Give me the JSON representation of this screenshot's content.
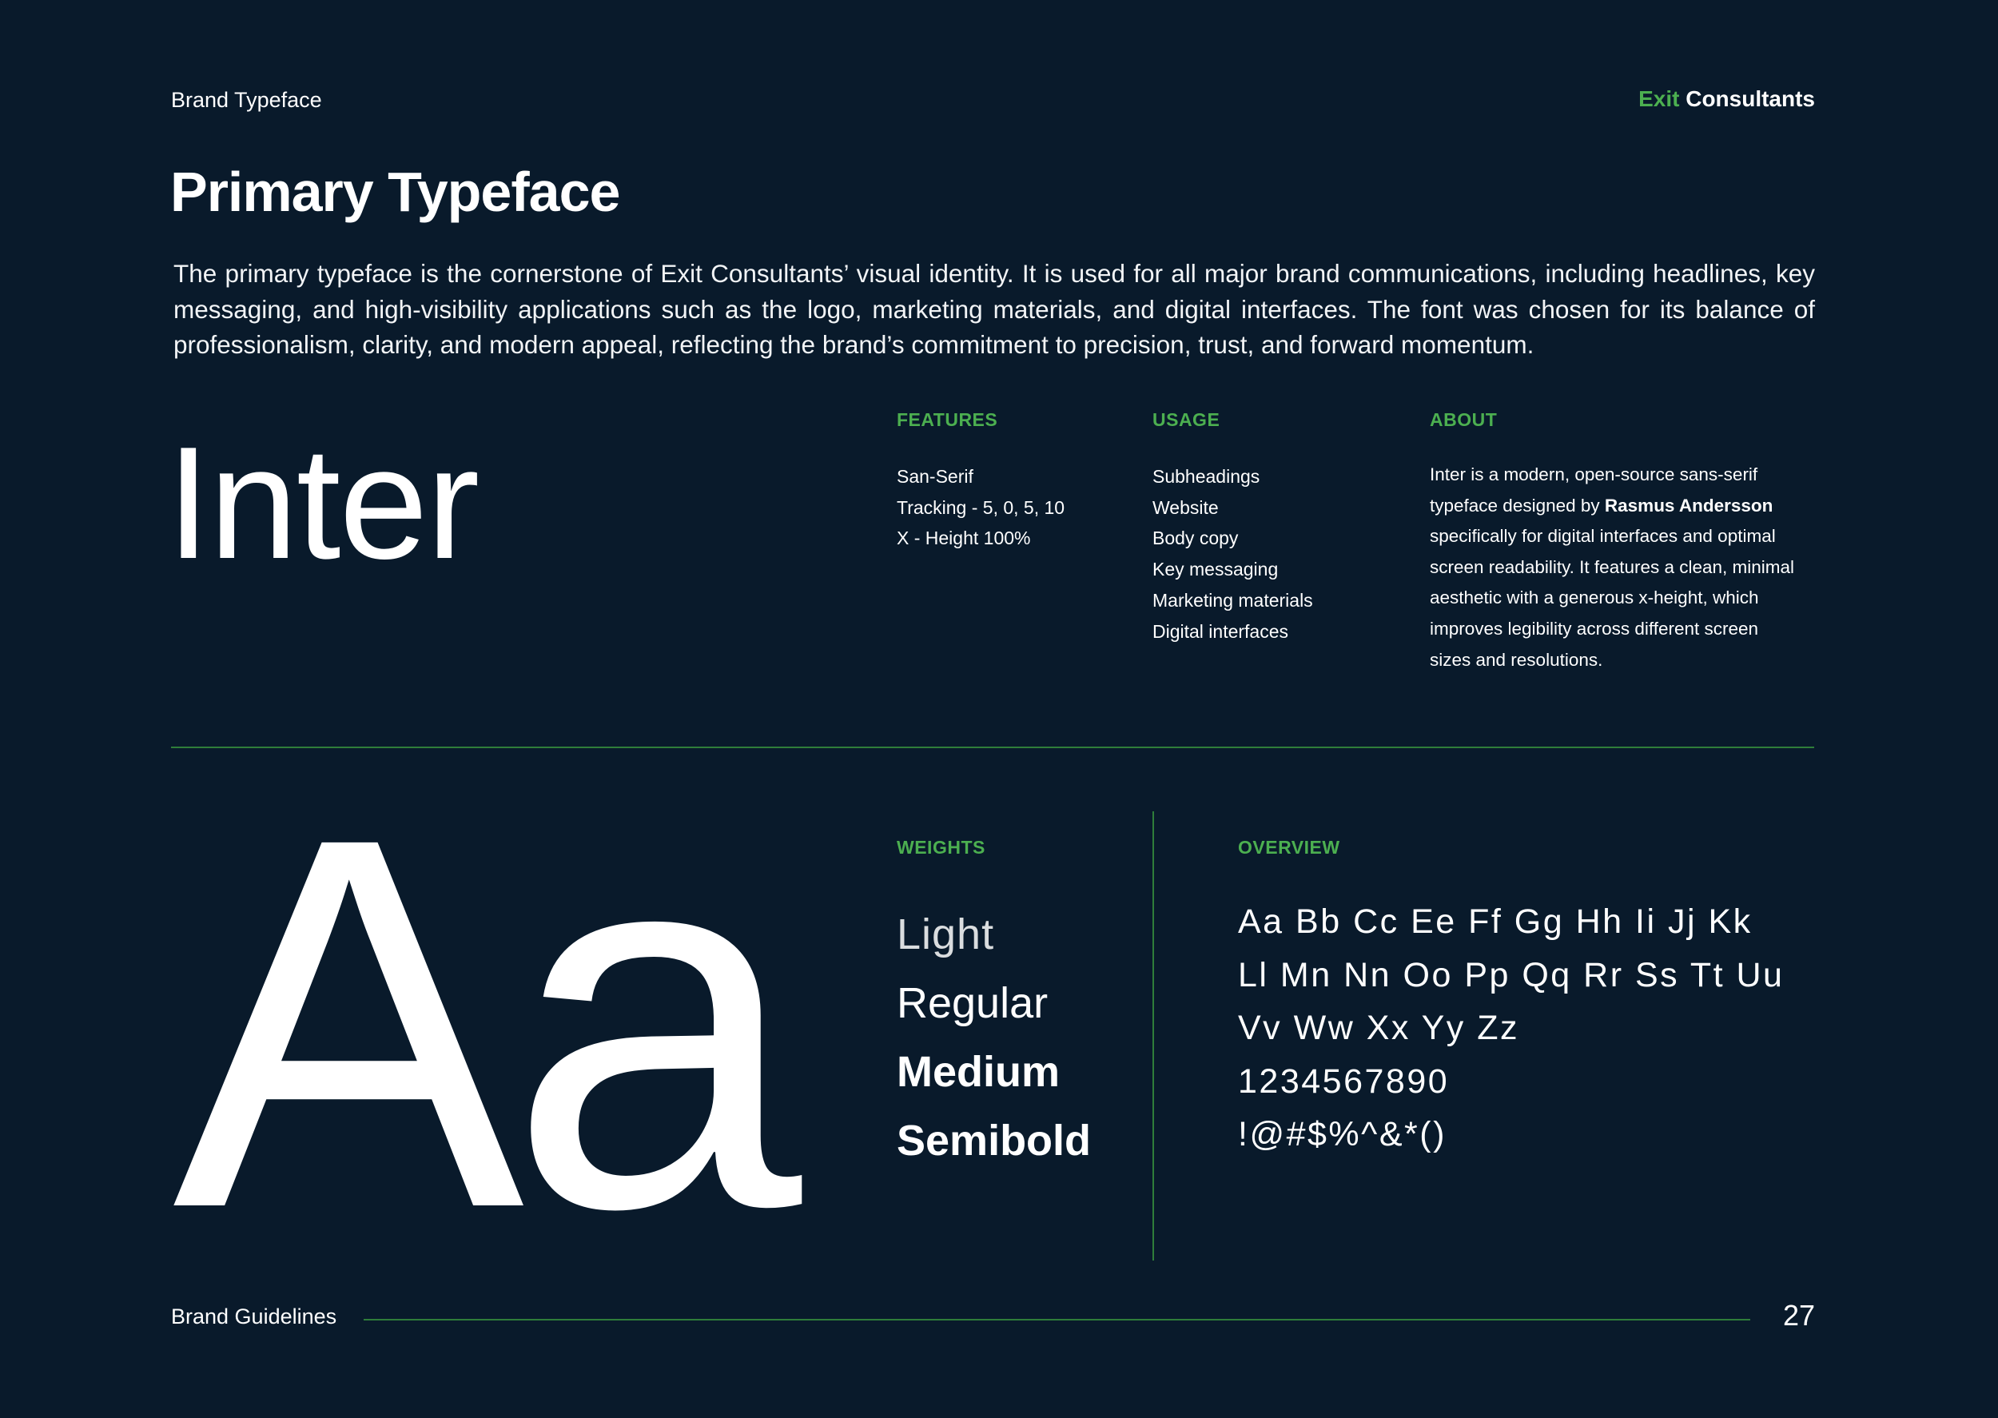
{
  "header": {
    "section_label": "Brand Typeface",
    "brand_accent": "Exit",
    "brand_rest": "Consultants"
  },
  "title": "Primary Typeface",
  "intro": "The primary typeface is the cornerstone of Exit Consultants’ visual identity. It is used for all major brand communications, including headlines, key messaging, and high-visibility applications such as the logo, marketing materials, and digital interfaces. The font was chosen for its balance of professionalism, clarity, and modern appeal, reflecting the brand’s commitment to precision, trust, and forward momentum.",
  "specimen": {
    "name": "Inter",
    "big_glyphs": "Aa"
  },
  "features": {
    "heading": "FEATURES",
    "items": [
      "San-Serif",
      "Tracking - 5, 0, 5, 10",
      "X - Height 100%"
    ]
  },
  "usage": {
    "heading": "USAGE",
    "items": [
      "Subheadings",
      "Website",
      "Body copy",
      "Key messaging",
      "Marketing materials",
      "Digital interfaces"
    ]
  },
  "about": {
    "heading": "ABOUT",
    "text_before": "Inter is a modern, open-source sans-serif typeface designed by ",
    "designer": "Rasmus Andersson",
    "text_after": " specifically for digital interfaces and optimal screen readability. It features a clean, minimal aesthetic with a generous x-height, which improves legibility across different screen sizes and resolutions."
  },
  "weights": {
    "heading": "WEIGHTS",
    "items": [
      "Light",
      "Regular",
      "Medium",
      "Semibold"
    ]
  },
  "overview": {
    "heading": "OVERVIEW",
    "lines": [
      "Aa Bb Cc Ee Ff Gg Hh Ii Jj Kk",
      "Ll Mn Nn Oo Pp Qq Rr Ss Tt Uu",
      "Vv Ww Xx Yy Zz",
      "1234567890",
      "!@#$%^&*()"
    ]
  },
  "footer": {
    "label": "Brand Guidelines",
    "page_number": "27"
  },
  "colors": {
    "background": "#091a2b",
    "accent": "#4caf50",
    "divider": "#2f7d3a",
    "text": "#ffffff"
  }
}
